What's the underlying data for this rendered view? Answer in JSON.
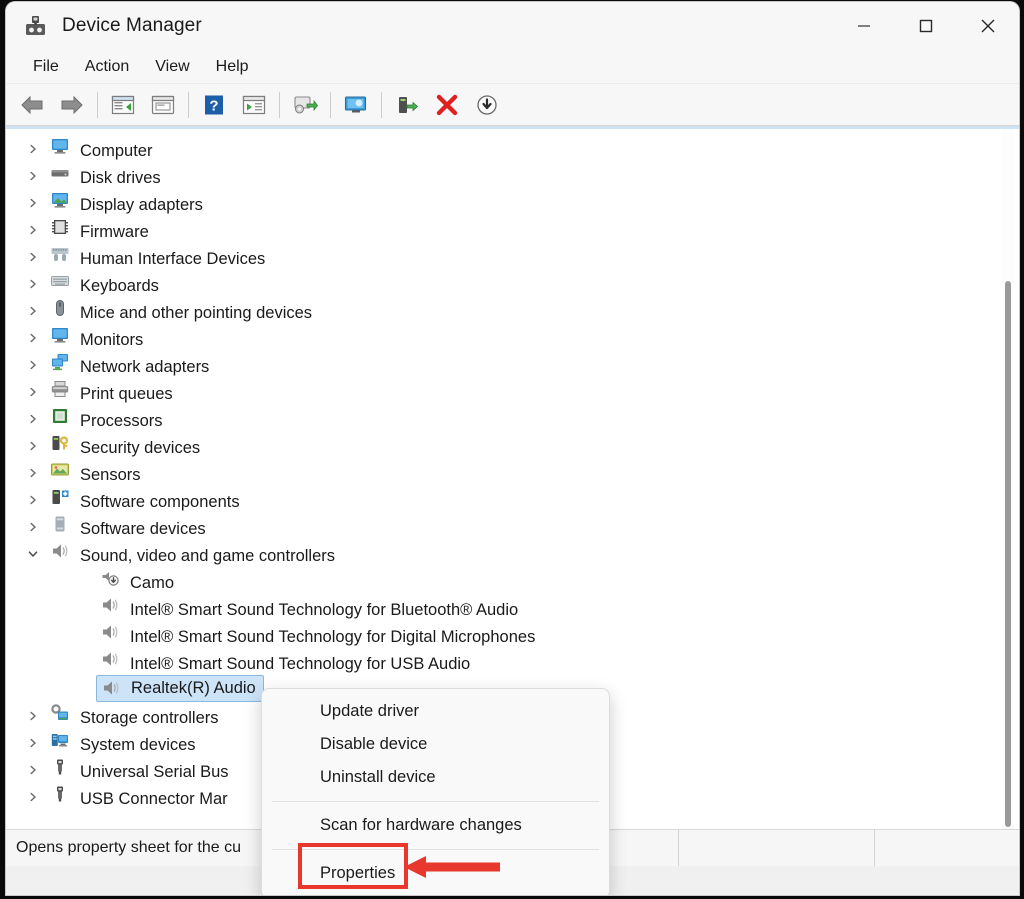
{
  "window": {
    "title": "Device Manager",
    "icon": "device-manager-icon",
    "controls": {
      "minimize": "minimize-icon",
      "maximize": "maximize-icon",
      "close": "close-icon"
    }
  },
  "menubar": {
    "items": [
      {
        "label": "File"
      },
      {
        "label": "Action"
      },
      {
        "label": "View"
      },
      {
        "label": "Help"
      }
    ]
  },
  "toolbar": {
    "buttons": [
      {
        "name": "back-arrow-icon",
        "kind": "back"
      },
      {
        "name": "forward-arrow-icon",
        "kind": "forward"
      },
      {
        "name": "separator",
        "kind": "sep"
      },
      {
        "name": "show-hide-console-tree-icon",
        "kind": "panel-left"
      },
      {
        "name": "properties-icon",
        "kind": "panel-plain"
      },
      {
        "name": "separator",
        "kind": "sep"
      },
      {
        "name": "help-icon",
        "kind": "help"
      },
      {
        "name": "update-driver-icon",
        "kind": "panel-play"
      },
      {
        "name": "separator",
        "kind": "sep"
      },
      {
        "name": "scan-for-hardware-changes-icon",
        "kind": "scan"
      },
      {
        "name": "separator",
        "kind": "sep"
      },
      {
        "name": "show-hidden-devices-icon",
        "kind": "monitor"
      },
      {
        "name": "separator",
        "kind": "sep"
      },
      {
        "name": "enable-device-icon",
        "kind": "enable"
      },
      {
        "name": "uninstall-device-icon",
        "kind": "redx"
      },
      {
        "name": "disable-device-icon",
        "kind": "downarrow"
      }
    ]
  },
  "tree": {
    "items": [
      {
        "label": "Computer",
        "icon": "computer-icon",
        "level": 0,
        "expanded": false,
        "selected": false
      },
      {
        "label": "Disk drives",
        "icon": "disk-drive-icon",
        "level": 0,
        "expanded": false,
        "selected": false
      },
      {
        "label": "Display adapters",
        "icon": "display-adapter-icon",
        "level": 0,
        "expanded": false,
        "selected": false
      },
      {
        "label": "Firmware",
        "icon": "firmware-icon",
        "level": 0,
        "expanded": false,
        "selected": false
      },
      {
        "label": "Human Interface Devices",
        "icon": "hid-icon",
        "level": 0,
        "expanded": false,
        "selected": false
      },
      {
        "label": "Keyboards",
        "icon": "keyboard-icon",
        "level": 0,
        "expanded": false,
        "selected": false
      },
      {
        "label": "Mice and other pointing devices",
        "icon": "mouse-icon",
        "level": 0,
        "expanded": false,
        "selected": false
      },
      {
        "label": "Monitors",
        "icon": "monitor-icon",
        "level": 0,
        "expanded": false,
        "selected": false
      },
      {
        "label": "Network adapters",
        "icon": "network-adapter-icon",
        "level": 0,
        "expanded": false,
        "selected": false
      },
      {
        "label": "Print queues",
        "icon": "printer-icon",
        "level": 0,
        "expanded": false,
        "selected": false
      },
      {
        "label": "Processors",
        "icon": "processor-icon",
        "level": 0,
        "expanded": false,
        "selected": false
      },
      {
        "label": "Security devices",
        "icon": "security-device-icon",
        "level": 0,
        "expanded": false,
        "selected": false
      },
      {
        "label": "Sensors",
        "icon": "sensor-icon",
        "level": 0,
        "expanded": false,
        "selected": false
      },
      {
        "label": "Software components",
        "icon": "software-component-icon",
        "level": 0,
        "expanded": false,
        "selected": false
      },
      {
        "label": "Software devices",
        "icon": "software-device-icon",
        "level": 0,
        "expanded": false,
        "selected": false
      },
      {
        "label": "Sound, video and game controllers",
        "icon": "speaker-icon",
        "level": 0,
        "expanded": true,
        "selected": false
      },
      {
        "label": "Camo",
        "icon": "camo-icon",
        "level": 1,
        "expanded": false,
        "selected": false
      },
      {
        "label": "Intel® Smart Sound Technology for Bluetooth® Audio",
        "icon": "speaker-icon",
        "level": 1,
        "expanded": false,
        "selected": false
      },
      {
        "label": "Intel® Smart Sound Technology for Digital Microphones",
        "icon": "speaker-icon",
        "level": 1,
        "expanded": false,
        "selected": false
      },
      {
        "label": "Intel® Smart Sound Technology for USB Audio",
        "icon": "speaker-icon",
        "level": 1,
        "expanded": false,
        "selected": false
      },
      {
        "label": "Realtek(R) Audio",
        "icon": "speaker-icon",
        "level": 1,
        "expanded": false,
        "selected": true
      },
      {
        "label": "Storage controllers",
        "icon": "storage-controller-icon",
        "level": 0,
        "expanded": false,
        "selected": false
      },
      {
        "label": "System devices",
        "icon": "system-device-icon",
        "level": 0,
        "expanded": false,
        "selected": false
      },
      {
        "label": "Universal Serial Bus",
        "icon": "usb-icon",
        "level": 0,
        "expanded": false,
        "selected": false
      },
      {
        "label": "USB Connector Mar",
        "icon": "usb-icon",
        "level": 0,
        "expanded": false,
        "selected": false
      }
    ]
  },
  "context_menu": {
    "items": [
      {
        "label": "Update driver",
        "type": "item"
      },
      {
        "label": "Disable device",
        "type": "item"
      },
      {
        "label": "Uninstall device",
        "type": "item"
      },
      {
        "label": "",
        "type": "separator"
      },
      {
        "label": "Scan for hardware changes",
        "type": "item"
      },
      {
        "label": "",
        "type": "separator"
      },
      {
        "label": "Properties",
        "type": "item",
        "highlighted": true
      }
    ]
  },
  "statusbar": {
    "text": "Opens property sheet for the cu"
  },
  "annotation": {
    "color": "#e8372c",
    "target": "Properties"
  },
  "colors": {
    "selection_fill": "#cde3f7",
    "selection_border": "#8bb8e0",
    "accent_strip": "#cfe3f3",
    "annotation_red": "#e8372c"
  }
}
